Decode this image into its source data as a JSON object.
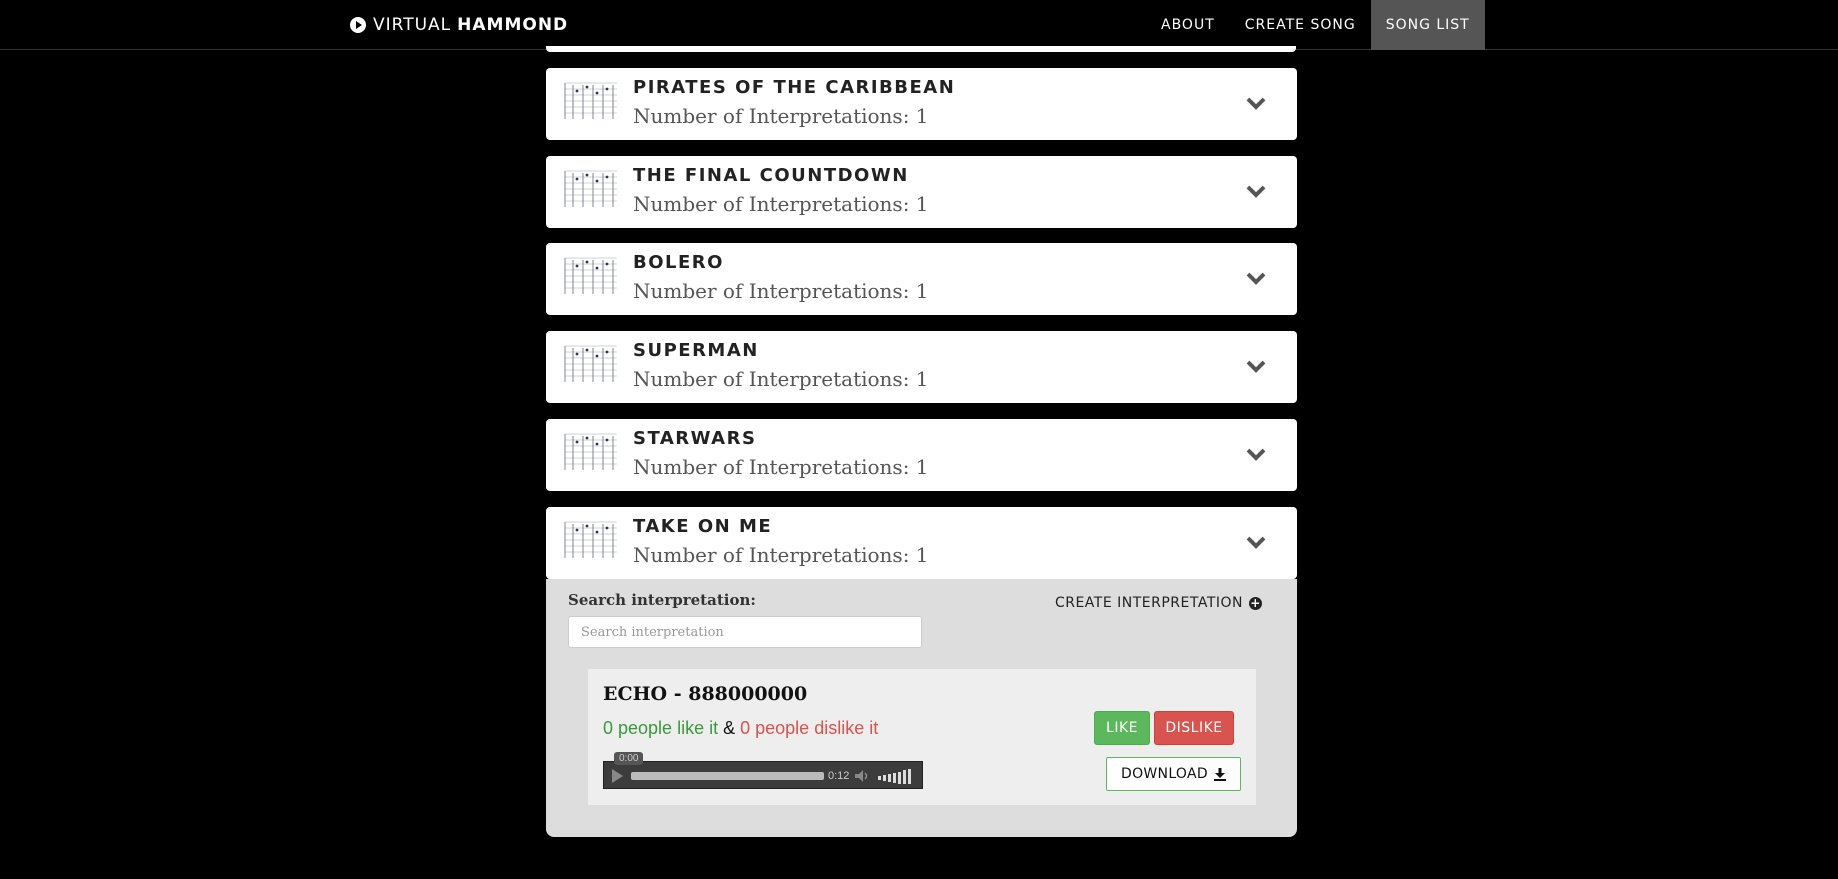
{
  "navbar": {
    "brand_light": "VIRTUAL",
    "brand_bold": "HAMMOND",
    "links": [
      {
        "label": "ABOUT",
        "active": false
      },
      {
        "label": "CREATE SONG",
        "active": false
      },
      {
        "label": "SONG LIST",
        "active": true
      }
    ]
  },
  "songs": [
    {
      "title": "PIRATES OF THE CARIBBEAN",
      "interpretations": "Number of Interpretations: 1"
    },
    {
      "title": "THE FINAL COUNTDOWN",
      "interpretations": "Number of Interpretations: 1"
    },
    {
      "title": "BOLERO",
      "interpretations": "Number of Interpretations: 1"
    },
    {
      "title": "SUPERMAN",
      "interpretations": "Number of Interpretations: 1"
    },
    {
      "title": "STARWARS",
      "interpretations": "Number of Interpretations: 1"
    },
    {
      "title": "TAKE ON ME",
      "interpretations": "Number of Interpretations: 1"
    }
  ],
  "panel": {
    "search_label": "Search interpretation:",
    "search_placeholder": "Search interpretation",
    "search_value": "",
    "create_label": "CREATE INTERPRETATION"
  },
  "interpretation": {
    "name": "ECHO - 888000000",
    "likes_text": "0 people like it",
    "amp": "&",
    "dislikes_text": "0 people dislike it",
    "current_time": "0:00",
    "duration": "0:12",
    "like_label": "LIKE",
    "dislike_label": "DISLIKE",
    "download_label": "DOWNLOAD"
  },
  "colors": {
    "like": "#5cb85c",
    "dislike": "#d9534f",
    "nav_active": "#555555"
  }
}
